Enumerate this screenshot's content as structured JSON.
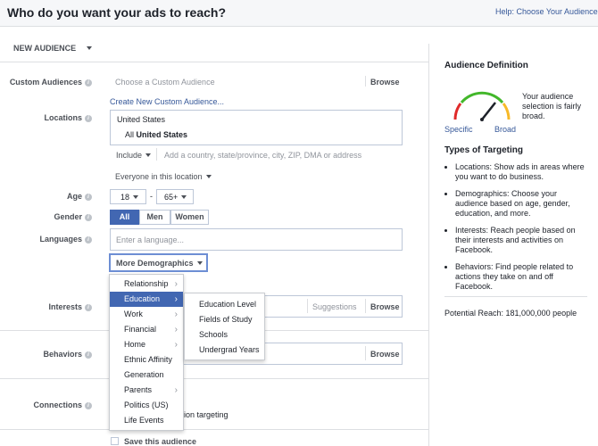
{
  "header": {
    "title": "Who do you want your ads to reach?",
    "help": "Help: Choose Your Audience"
  },
  "audience_menu": {
    "label": "NEW AUDIENCE"
  },
  "custom_audiences": {
    "label": "Custom Audiences",
    "placeholder": "Choose a Custom Audience",
    "browse": "Browse",
    "create_link": "Create New Custom Audience..."
  },
  "locations": {
    "label": "Locations",
    "country": "United States",
    "item_prefix": "All",
    "item_value": "United States",
    "include": "Include",
    "placeholder": "Add a country, state/province, city, ZIP, DMA or address",
    "everyone": "Everyone in this location"
  },
  "age": {
    "label": "Age",
    "min": "18",
    "sep": "-",
    "max": "65+"
  },
  "gender": {
    "label": "Gender",
    "options": [
      "All",
      "Men",
      "Women"
    ]
  },
  "languages": {
    "label": "Languages",
    "placeholder": "Enter a language..."
  },
  "more_demographics": {
    "label": "More Demographics"
  },
  "demographics_menu": [
    "Relationship",
    "Education",
    "Work",
    "Financial",
    "Home",
    "Ethnic Affinity",
    "Generation",
    "Parents",
    "Politics (US)",
    "Life Events"
  ],
  "education_submenu": [
    "Education Level",
    "Fields of Study",
    "Schools",
    "Undergrad Years"
  ],
  "interests": {
    "label": "Interests",
    "suggestions": "Suggestions",
    "browse": "Browse"
  },
  "behaviors": {
    "label": "Behaviors",
    "browse": "Browse"
  },
  "connections": {
    "label": "Connections",
    "partial_text": "ction targeting"
  },
  "save": {
    "label": "Save this audience"
  },
  "definition": {
    "title": "Audience Definition",
    "gauge_text": "Your audience selection is fairly broad.",
    "specific": "Specific",
    "broad": "Broad",
    "types_title": "Types of Targeting",
    "types": [
      "Locations: Show ads in areas where you want to do business.",
      "Demographics: Choose your audience based on age, gender, education, and more.",
      "Interests: Reach people based on their interests and activities on Facebook.",
      "Behaviors: Find people related to actions they take on and off Facebook."
    ],
    "reach": "Potential Reach: 181,000,000 people"
  },
  "colors": {
    "link": "#365899",
    "accent": "#4267b2",
    "gauge_red": "#e02a2a",
    "gauge_green": "#42b72a",
    "gauge_yellow": "#f7b928"
  }
}
